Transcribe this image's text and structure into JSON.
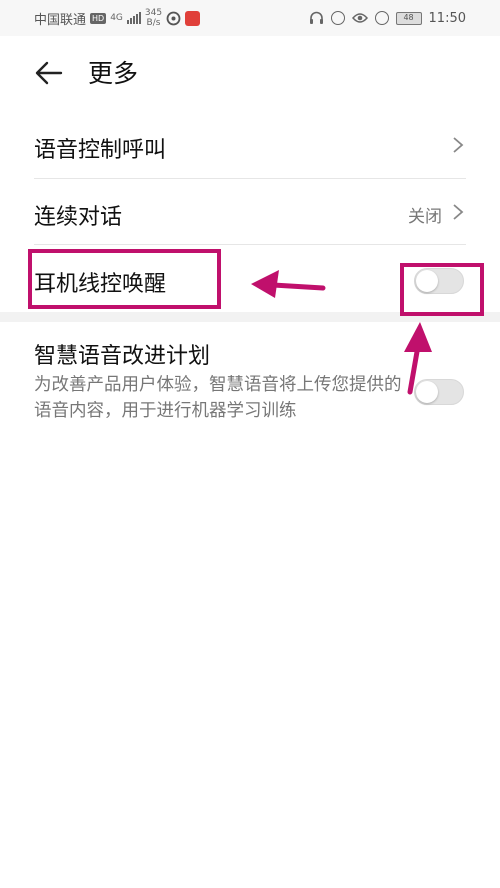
{
  "status_bar": {
    "carrier": "中国联通",
    "hd_badge": "HD",
    "network": "4G",
    "speed_value": "345",
    "speed_unit": "B/s",
    "battery": "48",
    "time": "11:50"
  },
  "header": {
    "title": "更多"
  },
  "settings": {
    "voice_call": {
      "label": "语音控制呼叫"
    },
    "continuous": {
      "label": "连续对话",
      "value": "关闭"
    },
    "headset_wake": {
      "label": "耳机线控唤醒",
      "toggle_on": false
    },
    "improve": {
      "label": "智慧语音改进计划",
      "desc": "为改善产品用户体验，智慧语音将上传您提供的语音内容，用于进行机器学习训练",
      "toggle_on": false
    }
  },
  "colors": {
    "annotation": "#c0106c",
    "toggle_off": "#e4e4e4"
  }
}
